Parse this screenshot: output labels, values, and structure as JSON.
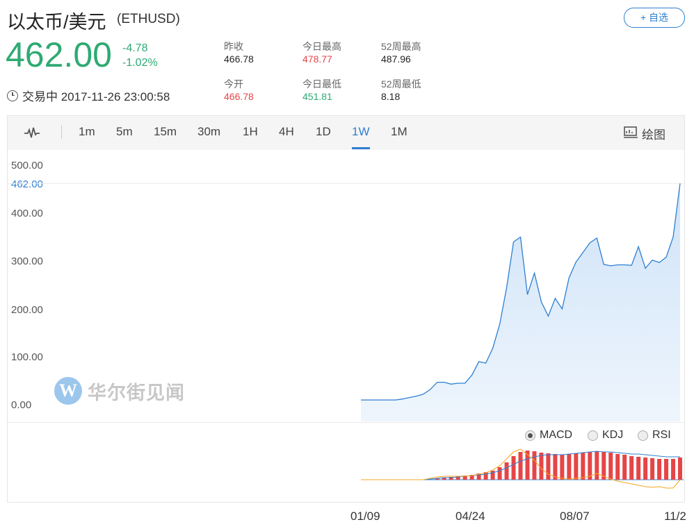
{
  "header": {
    "title": "以太币/美元",
    "symbol": "(ETHUSD)",
    "price": "462.00",
    "change": "-4.78",
    "change_pct": "-1.02%",
    "status_time": "交易中 2017-11-26 23:00:58",
    "watch_label": "+ 自选"
  },
  "stats": [
    {
      "label": "昨收",
      "value": "466.78",
      "tone": "neutral"
    },
    {
      "label": "今日最高",
      "value": "478.77",
      "tone": "red"
    },
    {
      "label": "52周最高",
      "value": "487.96",
      "tone": "neutral"
    },
    {
      "label": "今开",
      "value": "466.78",
      "tone": "red"
    },
    {
      "label": "今日最低",
      "value": "451.81",
      "tone": "green"
    },
    {
      "label": "52周最低",
      "value": "8.18",
      "tone": "neutral"
    }
  ],
  "toolbar": {
    "intervals": [
      "1m",
      "5m",
      "15m",
      "30m",
      "1H",
      "4H",
      "1D",
      "1W",
      "1M"
    ],
    "active": "1W",
    "draw_label": "绘图"
  },
  "indicators": {
    "options": [
      "MACD",
      "KDJ",
      "RSI"
    ],
    "selected": "MACD"
  },
  "watermark": "华尔街见闻",
  "colors": {
    "accent": "#2d7fd1",
    "up": "#e64547",
    "down": "#2eaa73",
    "line": "#2d7fd1",
    "area": "#cfe3f8",
    "signal": "#f5a623"
  },
  "chart_data": [
    {
      "type": "area",
      "y_ticks": [
        "0.00",
        "100.00",
        "200.00",
        "300.00",
        "400.00",
        "500.00"
      ],
      "ylim": [
        0,
        500
      ],
      "last_value_label": "462.00",
      "x_tick_labels": [
        "01/09",
        "04/24",
        "08/07",
        "11/2"
      ],
      "values": [
        10,
        10,
        10,
        10,
        10,
        10,
        12,
        15,
        18,
        22,
        32,
        47,
        47,
        43,
        45,
        45,
        62,
        90,
        87,
        118,
        168,
        244,
        340,
        350,
        230,
        275,
        215,
        185,
        222,
        200,
        265,
        298,
        318,
        338,
        348,
        293,
        290,
        292,
        292,
        291,
        330,
        285,
        302,
        297,
        308,
        350,
        462
      ],
      "grid": true
    },
    {
      "type": "bar",
      "indicator": "MACD",
      "histogram": [
        0,
        0,
        0,
        0,
        0,
        0,
        0,
        0,
        0,
        0,
        0,
        2,
        3,
        4,
        5,
        6,
        7,
        9,
        11,
        13,
        18,
        25,
        34,
        40,
        42,
        41,
        39,
        38,
        37,
        36,
        37,
        38,
        39,
        40,
        41,
        40,
        39,
        37,
        36,
        34,
        33,
        32,
        31,
        30,
        30,
        30,
        32
      ],
      "macd_line": [
        0,
        0,
        0,
        0,
        0,
        0,
        0,
        0,
        0,
        0,
        1,
        2,
        3,
        3,
        4,
        5,
        6,
        7,
        8,
        10,
        13,
        17,
        22,
        27,
        30,
        33,
        35,
        36,
        36,
        36,
        37,
        38,
        39,
        40,
        41,
        40,
        40,
        39,
        38,
        37,
        37,
        36,
        35,
        34,
        33,
        33,
        33
      ],
      "signal_line": [
        0,
        0,
        0,
        0,
        0,
        0,
        0,
        0,
        0,
        0,
        2,
        4,
        5,
        5,
        5,
        5,
        6,
        8,
        10,
        14,
        20,
        30,
        40,
        44,
        36,
        28,
        16,
        8,
        4,
        2,
        1,
        2,
        3,
        5,
        9,
        5,
        1,
        -2,
        -4,
        -6,
        -8,
        -10,
        -11,
        -10,
        -12,
        -12,
        0
      ]
    }
  ]
}
